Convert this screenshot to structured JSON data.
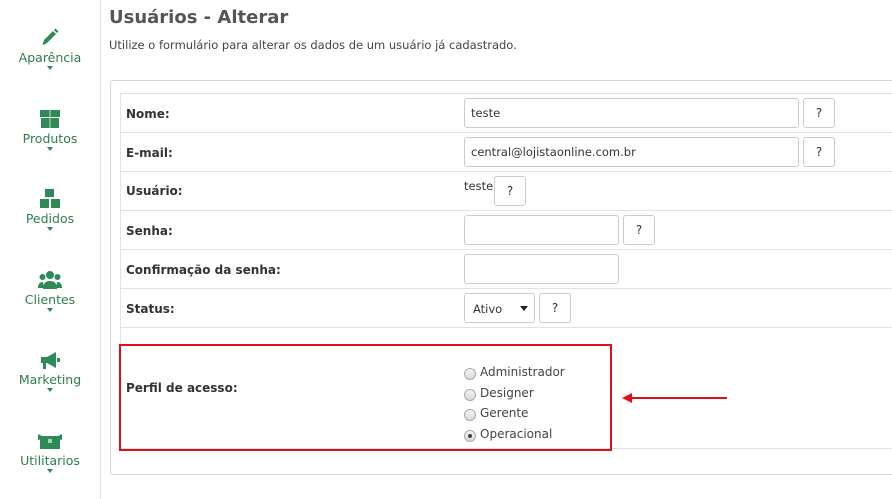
{
  "sidebar": {
    "items": [
      {
        "label": "Aparência",
        "icon": "pencil-icon"
      },
      {
        "label": "Produtos",
        "icon": "box-icon"
      },
      {
        "label": "Pedidos",
        "icon": "boxes-icon"
      },
      {
        "label": "Clientes",
        "icon": "users-icon"
      },
      {
        "label": "Marketing",
        "icon": "megaphone-icon"
      },
      {
        "label": "Utilitarios",
        "icon": "toolbox-icon"
      }
    ],
    "accent_color": "#2e8b57"
  },
  "header": {
    "title": "Usuários - Alterar",
    "subtitle": "Utilize o formulário para alterar os dados de um usuário já cadastrado."
  },
  "form": {
    "nome": {
      "label": "Nome:",
      "value": "teste"
    },
    "email": {
      "label": "E-mail:",
      "value": "central@lojistaonline.com.br"
    },
    "usuario": {
      "label": "Usuário:",
      "value": "teste"
    },
    "senha": {
      "label": "Senha:",
      "value": ""
    },
    "confirmacao": {
      "label": "Confirmação da senha:",
      "value": ""
    },
    "status": {
      "label": "Status:",
      "selected": "Ativo"
    },
    "perfil": {
      "label": "Perfil de acesso:",
      "options": [
        "Administrador",
        "Designer",
        "Gerente",
        "Operacional"
      ],
      "selected": "Operacional"
    },
    "help_label": "?"
  },
  "annotation": {
    "color": "#e0101a"
  }
}
